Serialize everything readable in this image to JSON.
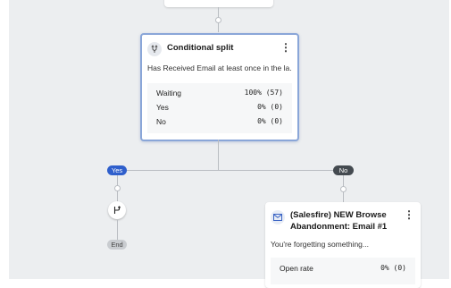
{
  "split_card": {
    "title": "Conditional split",
    "description": "Has Received Email at least once in the la...",
    "stats": [
      {
        "label": "Waiting",
        "value": "100% (57)"
      },
      {
        "label": "Yes",
        "value": "0% (0)"
      },
      {
        "label": "No",
        "value": "0% (0)"
      }
    ]
  },
  "branches": {
    "yes_label": "Yes",
    "no_label": "No",
    "end_label": "End"
  },
  "email_card": {
    "title_line1": "(Salesfire) NEW Browse",
    "title_line2": "Abandonment: Email #1",
    "subject": "You're forgetting something...",
    "stats": [
      {
        "label": "Open rate",
        "value": "0% (0)"
      }
    ]
  },
  "colors": {
    "yes_pill": "#2f5fcc",
    "no_pill": "#444a50",
    "selected_border": "#8aa6d8",
    "canvas": "#eceef0"
  },
  "icons": {
    "split": "split-arrows-icon",
    "email": "envelope-icon",
    "action": "branch-action-icon",
    "menu": "kebab-menu-icon"
  }
}
